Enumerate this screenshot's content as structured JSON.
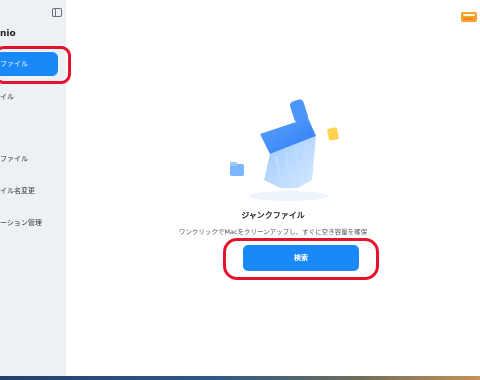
{
  "app": {
    "name": "nio"
  },
  "sidebar": {
    "items": [
      {
        "label": "ファイル",
        "active": true
      },
      {
        "label": "イル",
        "active": false
      },
      {
        "label": "ファイル",
        "active": false
      },
      {
        "label": "イル名変更",
        "active": false
      },
      {
        "label": "ーション管理",
        "active": false
      }
    ]
  },
  "main": {
    "title": "ジャンクファイル",
    "description": "ワンクリックでMacをクリーンアップし、すぐに空き容量を確保",
    "scan_button": "検索"
  },
  "colors": {
    "accent": "#1a89f8",
    "highlight": "#e4122a",
    "sidebar_bg": "#edf0f4"
  }
}
